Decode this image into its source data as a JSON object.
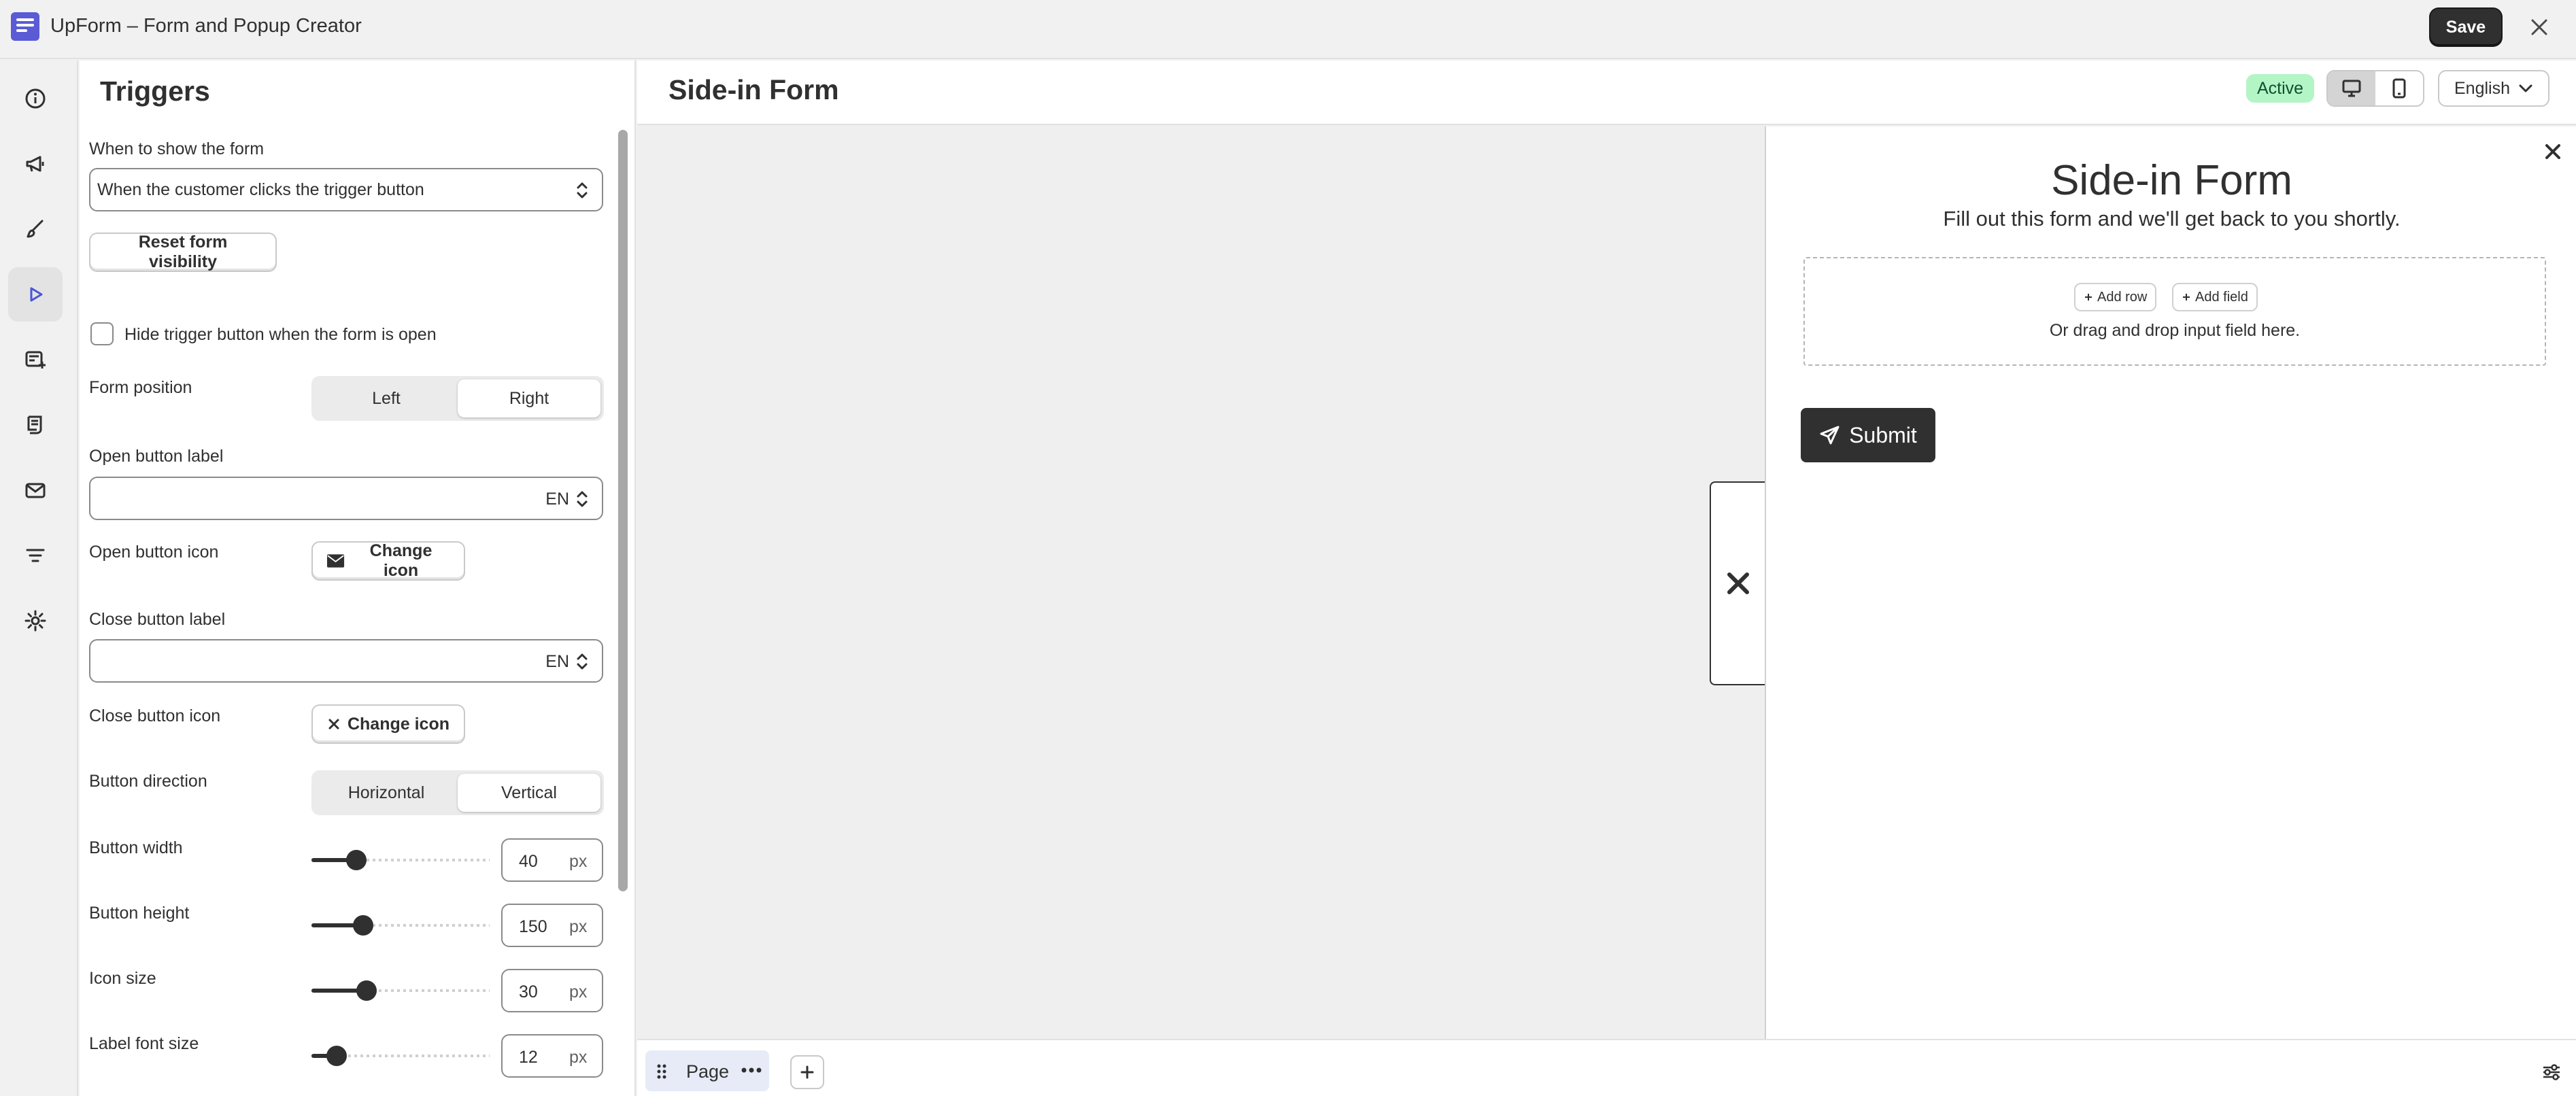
{
  "app": {
    "title": "UpForm – Form and Popup Creator",
    "save_label": "Save"
  },
  "rail": [
    "info-icon",
    "megaphone-icon",
    "brush-icon",
    "play-icon",
    "form-plus-icon",
    "receipt-icon",
    "mail-icon",
    "filter-icon",
    "gear-icon"
  ],
  "panel": {
    "title": "Triggers",
    "when_label": "When to show the form",
    "when_value": "When the customer clicks the trigger button",
    "reset_label": "Reset form visibility",
    "hide_trigger_label": "Hide trigger button when the form is open",
    "hide_trigger_checked": false,
    "position_label": "Form position",
    "position_options": [
      "Left",
      "Right"
    ],
    "position_selected": "Right",
    "open_label_label": "Open button label",
    "open_label_value": "",
    "open_label_lang": "EN",
    "open_icon_label": "Open button icon",
    "open_icon_btn": "Change icon",
    "close_label_label": "Close button label",
    "close_label_value": "",
    "close_label_lang": "EN",
    "close_icon_label": "Close button icon",
    "close_icon_btn": "Change icon",
    "direction_label": "Button direction",
    "direction_options": [
      "Horizontal",
      "Vertical"
    ],
    "direction_selected": "Vertical",
    "sliders": [
      {
        "label": "Button width",
        "value": "40",
        "unit": "px",
        "fraction": 0.25
      },
      {
        "label": "Button height",
        "value": "150",
        "unit": "px",
        "fraction": 0.29
      },
      {
        "label": "Icon size",
        "value": "30",
        "unit": "px",
        "fraction": 0.31
      },
      {
        "label": "Label font size",
        "value": "12",
        "unit": "px",
        "fraction": 0.14
      }
    ]
  },
  "main": {
    "title": "Side-in Form",
    "status": "Active",
    "status_color": "#b4f5c6",
    "language": "English",
    "form": {
      "title": "Side-in Form",
      "subtitle": "Fill out this form and we'll get back to you shortly.",
      "add_row": "Add row",
      "add_field": "Add field",
      "drop_hint": "Or drag and drop input field here.",
      "submit": "Submit"
    },
    "page_tab": "Page"
  }
}
